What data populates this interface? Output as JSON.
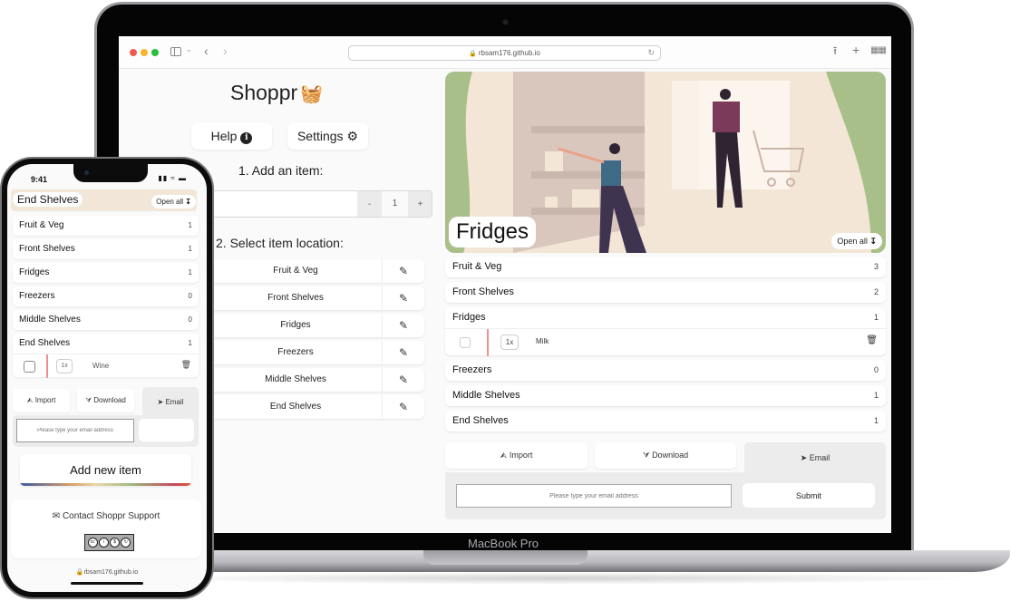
{
  "laptop": {
    "model_label": "MacBook Pro",
    "browser": {
      "url": "rbsam176.github.io",
      "lock_icon": "lock-icon",
      "back_icon": "chevron-left-icon",
      "forward_icon": "chevron-right-icon",
      "share_icon": "share-icon",
      "new_tab_icon": "plus-icon",
      "tabs_icon": "tab-grid-icon",
      "reload_icon": "reload-icon"
    },
    "app": {
      "brand": "Shoppr",
      "brand_icon": "basket-icon",
      "help_label": "Help",
      "settings_label": "Settings",
      "step1_label": "1. Add an item:",
      "item_input_value": "",
      "quantity": "1",
      "minus_label": "-",
      "plus_label": "+",
      "step2_label": "2. Select item location:",
      "locations": [
        {
          "label": "Fruit & Veg"
        },
        {
          "label": "Front Shelves"
        },
        {
          "label": "Fridges"
        },
        {
          "label": "Freezers"
        },
        {
          "label": "Middle Shelves"
        },
        {
          "label": "End Shelves"
        }
      ],
      "hero_title": "Fridges",
      "open_all_label": "Open all",
      "categories": [
        {
          "name": "Fruit & Veg",
          "count": "3"
        },
        {
          "name": "Front Shelves",
          "count": "2"
        },
        {
          "name": "Fridges",
          "count": "1",
          "items": [
            {
              "qty": "1x",
              "name": "Milk"
            }
          ]
        },
        {
          "name": "Freezers",
          "count": "0"
        },
        {
          "name": "Middle Shelves",
          "count": "1"
        },
        {
          "name": "End Shelves",
          "count": "1"
        }
      ],
      "import_label": "Import",
      "download_label": "Download",
      "email_label": "Email",
      "email_placeholder": "Please type your email address",
      "submit_label": "Submit"
    }
  },
  "phone": {
    "time": "9:41",
    "hero_title": "End Shelves",
    "open_all_label": "Open all",
    "categories": [
      {
        "name": "Fruit & Veg",
        "count": "1"
      },
      {
        "name": "Front Shelves",
        "count": "1"
      },
      {
        "name": "Fridges",
        "count": "1"
      },
      {
        "name": "Freezers",
        "count": "0"
      },
      {
        "name": "Middle Shelves",
        "count": "0"
      },
      {
        "name": "End Shelves",
        "count": "1",
        "items": [
          {
            "qty": "1x",
            "name": "Wine"
          }
        ]
      }
    ],
    "import_label": "Import",
    "download_label": "Download",
    "email_label": "Email",
    "email_placeholder": "Please type your email address",
    "add_new_item_label": "Add new item",
    "contact_label": "Contact Shoppr Support",
    "license_badge": "CC BY NC SA",
    "url": "rbsam176.github.io"
  },
  "colors": {
    "hero_green": "#a9bf8a",
    "hero_cream": "#f3e6d6",
    "item_accent_red": "#f08f8f",
    "panel_gray": "#ececec"
  }
}
